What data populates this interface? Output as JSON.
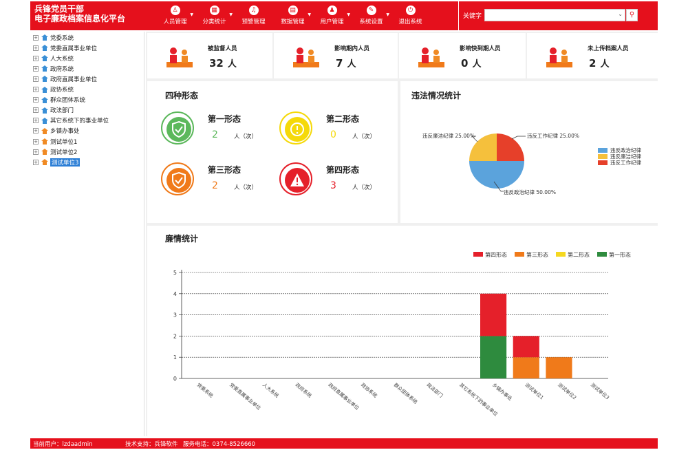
{
  "header": {
    "brand_line1": "兵锋党员干部",
    "brand_line2": "电子廉政档案信息化平台",
    "nav": [
      {
        "label": "人员管理",
        "icon": "person-icon",
        "glyph": "♙",
        "caret": true
      },
      {
        "label": "分类统计",
        "icon": "chart-icon",
        "glyph": "▦",
        "caret": true
      },
      {
        "label": "预警管理",
        "icon": "bell-icon",
        "glyph": "♫",
        "caret": false
      },
      {
        "label": "数据管理",
        "icon": "database-icon",
        "glyph": "▤",
        "caret": true
      },
      {
        "label": "用户管理",
        "icon": "user-icon",
        "glyph": "♟",
        "caret": true
      },
      {
        "label": "系统设置",
        "icon": "settings-icon",
        "glyph": "✎",
        "caret": true
      },
      {
        "label": "退出系统",
        "icon": "power-icon",
        "glyph": "⏻",
        "caret": false
      }
    ],
    "search_label": "关键字",
    "search_value": ""
  },
  "tree": [
    {
      "label": "党委系统",
      "color": "blue"
    },
    {
      "label": "党委直属事业单位",
      "color": "blue"
    },
    {
      "label": "人大系统",
      "color": "blue"
    },
    {
      "label": "政府系统",
      "color": "blue"
    },
    {
      "label": "政府直属事业单位",
      "color": "blue"
    },
    {
      "label": "政协系统",
      "color": "blue"
    },
    {
      "label": "群众团体系统",
      "color": "blue"
    },
    {
      "label": "政法部门",
      "color": "blue"
    },
    {
      "label": "其它系统下的事业单位",
      "color": "blue"
    },
    {
      "label": "乡镇办事处",
      "color": "orange"
    },
    {
      "label": "测试单位1",
      "color": "orange"
    },
    {
      "label": "测试单位2",
      "color": "orange"
    },
    {
      "label": "测试单位3",
      "color": "orange",
      "selected": true
    }
  ],
  "stats": [
    {
      "label": "被监督人员",
      "value": "32",
      "unit": "人"
    },
    {
      "label": "影响期内人员",
      "value": "7",
      "unit": "人"
    },
    {
      "label": "影响快到期人员",
      "value": "0",
      "unit": "人"
    },
    {
      "label": "未上传档案人员",
      "value": "2",
      "unit": "人"
    }
  ],
  "forms_title": "四种形态",
  "forms": [
    {
      "name": "第一形态",
      "count": "2",
      "unit": "人（次）",
      "color": "#5cb85c",
      "icon": "shield-check-icon"
    },
    {
      "name": "第二形态",
      "count": "0",
      "unit": "人（次）",
      "color": "#f5d90a",
      "icon": "alert-circle-icon"
    },
    {
      "name": "第三形态",
      "count": "2",
      "unit": "人（次）",
      "color": "#f07a1a",
      "icon": "shield-check-orange-icon"
    },
    {
      "name": "第四形态",
      "count": "3",
      "unit": "人（次）",
      "color": "#e5202a",
      "icon": "warning-triangle-icon"
    }
  ],
  "violation_title": "违法情况统计",
  "pie_chart": {
    "type": "pie",
    "slices": [
      {
        "name": "违反政治纪律",
        "value": 50,
        "label": "违反政治纪律 50.00%",
        "color": "#5ba3dc"
      },
      {
        "name": "违反廉洁纪律",
        "value": 25,
        "label": "违反廉洁纪律 25.00%",
        "color": "#f5c03c"
      },
      {
        "name": "违反工作纪律",
        "value": 25,
        "label": "违反工作纪律 25.00%",
        "color": "#e6402a"
      }
    ],
    "legend": [
      "违反政治纪律",
      "违反廉洁纪律",
      "违反工作纪律"
    ]
  },
  "chart_title": "廉情统计",
  "chart_data": {
    "type": "bar",
    "stacked": true,
    "categories": [
      "党委系统",
      "党委直属事业单位",
      "人大系统",
      "政府系统",
      "政府直属事业单位",
      "政协系统",
      "群众团体系统",
      "政法部门",
      "其它系统下的事业单位",
      "乡镇办事处",
      "测试单位1",
      "测试单位2",
      "测试单位3"
    ],
    "series": [
      {
        "name": "第一形态",
        "color": "#2e8b3e",
        "values": [
          0,
          0,
          0,
          0,
          0,
          0,
          0,
          0,
          0,
          2,
          0,
          0,
          0
        ]
      },
      {
        "name": "第二形态",
        "color": "#f5d820",
        "values": [
          0,
          0,
          0,
          0,
          0,
          0,
          0,
          0,
          0,
          0,
          0,
          0,
          0
        ]
      },
      {
        "name": "第三形态",
        "color": "#f07a1a",
        "values": [
          0,
          0,
          0,
          0,
          0,
          0,
          0,
          0,
          0,
          0,
          1,
          1,
          0
        ]
      },
      {
        "name": "第四形态",
        "color": "#e5202a",
        "values": [
          0,
          0,
          0,
          0,
          0,
          0,
          0,
          0,
          0,
          2,
          1,
          0,
          0
        ]
      }
    ],
    "legend_order": [
      "第四形态",
      "第三形态",
      "第二形态",
      "第一形态"
    ],
    "ylim": [
      0,
      5
    ],
    "yticks": [
      "0",
      "1",
      "2",
      "3",
      "4",
      "5"
    ],
    "grid": true,
    "legend_position": "top-right"
  },
  "footer": {
    "user": "当前用户：lzdaadmin",
    "support": "技术支持：兵锋软件",
    "phone": "服务电话：0374-8526660"
  }
}
